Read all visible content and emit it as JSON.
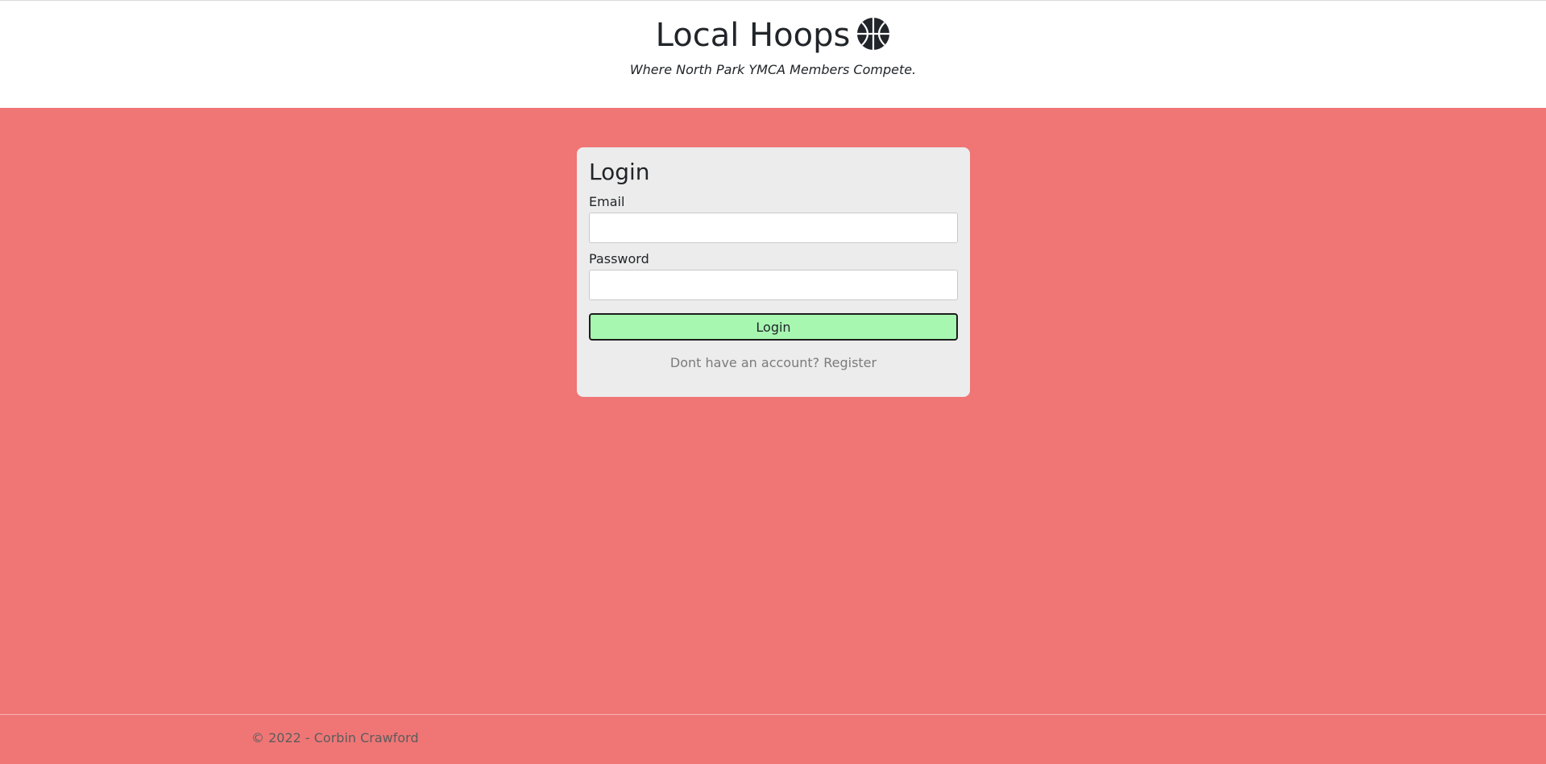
{
  "header": {
    "title": "Local Hoops",
    "logo_icon": "basketball-icon",
    "tagline": "Where North Park YMCA Members Compete."
  },
  "login_form": {
    "heading": "Login",
    "email_label": "Email",
    "email_value": "",
    "password_label": "Password",
    "password_value": "",
    "submit_label": "Login",
    "register_prompt": "Dont have an account?",
    "register_link": "Register"
  },
  "footer": {
    "text": "© 2022 - Corbin Crawford"
  },
  "colors": {
    "background": "#f07676",
    "card": "#ececec",
    "login_button": "#a7f7b1"
  }
}
